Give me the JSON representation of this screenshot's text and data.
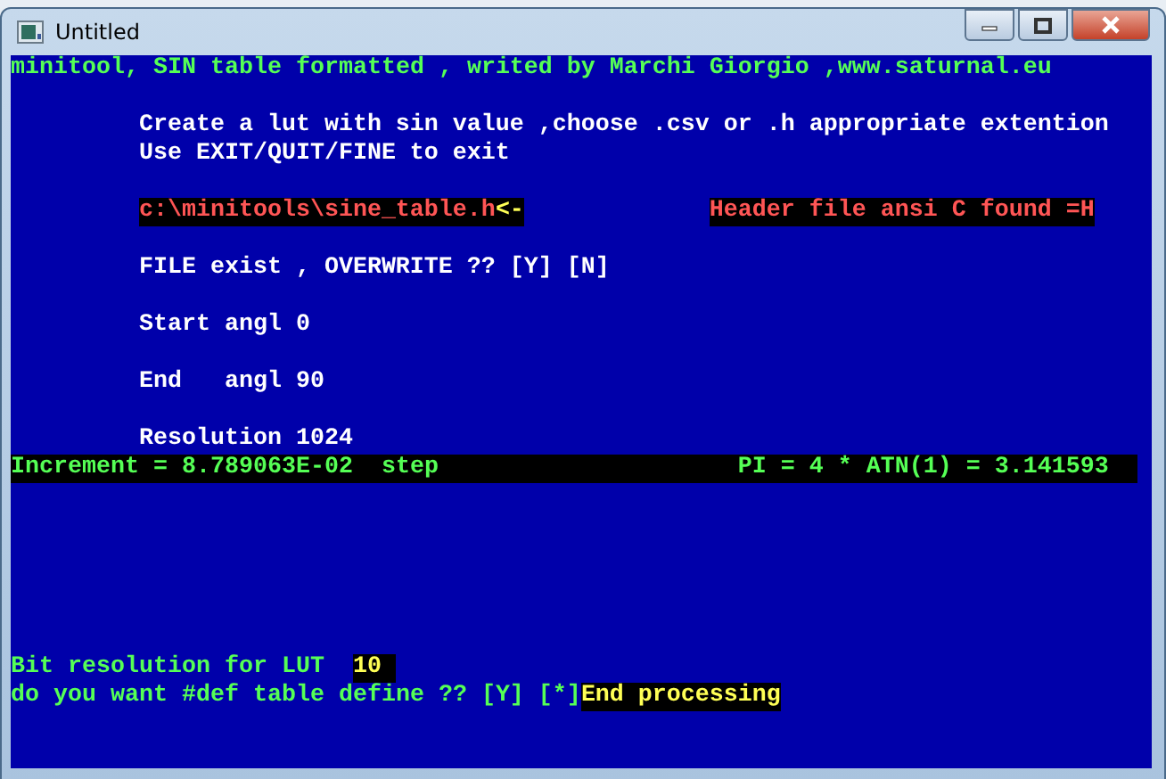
{
  "window": {
    "title": "Untitled"
  },
  "console": [
    {
      "kind": "plain",
      "segments": [
        {
          "text": "minitool, SIN table formatted , writed by Marchi Giorgio ,www.saturnal.eu",
          "kind": "green",
          "highlighted": false
        }
      ]
    },
    {
      "kind": "blank"
    },
    {
      "kind": "indented",
      "segments": [
        {
          "text": "Create a lut with sin value ,choose .csv or .h appropriate extention",
          "kind": "white",
          "highlighted": false
        }
      ]
    },
    {
      "kind": "indented",
      "segments": [
        {
          "text": "Use EXIT/QUIT/FINE to exit",
          "kind": "white",
          "highlighted": false
        }
      ]
    },
    {
      "kind": "blank"
    },
    {
      "kind": "indented",
      "segments": [
        {
          "text": "c:\\minitools\\sine_table.h",
          "kind": "red",
          "highlighted": true
        },
        {
          "text": "<-",
          "kind": "yellow",
          "highlighted": true
        }
      ],
      "right": {
        "text": "Header file ansi C found =H",
        "kind": "red",
        "highlighted": true
      }
    },
    {
      "kind": "blank"
    },
    {
      "kind": "indented",
      "segments": [
        {
          "text": "FILE exist , OVERWRITE ?? [Y] [N]",
          "kind": "white",
          "highlighted": false
        }
      ]
    },
    {
      "kind": "blank"
    },
    {
      "kind": "indented",
      "segments": [
        {
          "text": "Start angl 0",
          "kind": "white",
          "highlighted": false
        }
      ]
    },
    {
      "kind": "blank"
    },
    {
      "kind": "indented",
      "segments": [
        {
          "text": "End   angl 90",
          "kind": "white",
          "highlighted": false
        }
      ]
    },
    {
      "kind": "blank"
    },
    {
      "kind": "indented",
      "segments": [
        {
          "text": "Resolution 1024",
          "kind": "white",
          "highlighted": false
        }
      ]
    },
    {
      "kind": "bar",
      "segments": [
        {
          "text": "Increment = 8.789063E-02  step",
          "kind": "green"
        }
      ],
      "right": {
        "text": "PI = 4 * ATN(1) = 3.141593",
        "kind": "green"
      }
    },
    {
      "kind": "blank"
    },
    {
      "kind": "blank"
    },
    {
      "kind": "blank"
    },
    {
      "kind": "blank"
    },
    {
      "kind": "blank"
    },
    {
      "kind": "blank"
    },
    {
      "kind": "plain",
      "segments": [
        {
          "text": "Bit resolution for LUT  ",
          "kind": "green",
          "highlighted": false
        },
        {
          "text": "10 ",
          "kind": "yellow",
          "highlighted": true
        }
      ]
    },
    {
      "kind": "plain",
      "segments": [
        {
          "text": "do you want #def table define ?? [Y] [*]",
          "kind": "green",
          "highlighted": false
        },
        {
          "text": "End processing",
          "kind": "yellow",
          "highlighted": true
        }
      ]
    }
  ]
}
